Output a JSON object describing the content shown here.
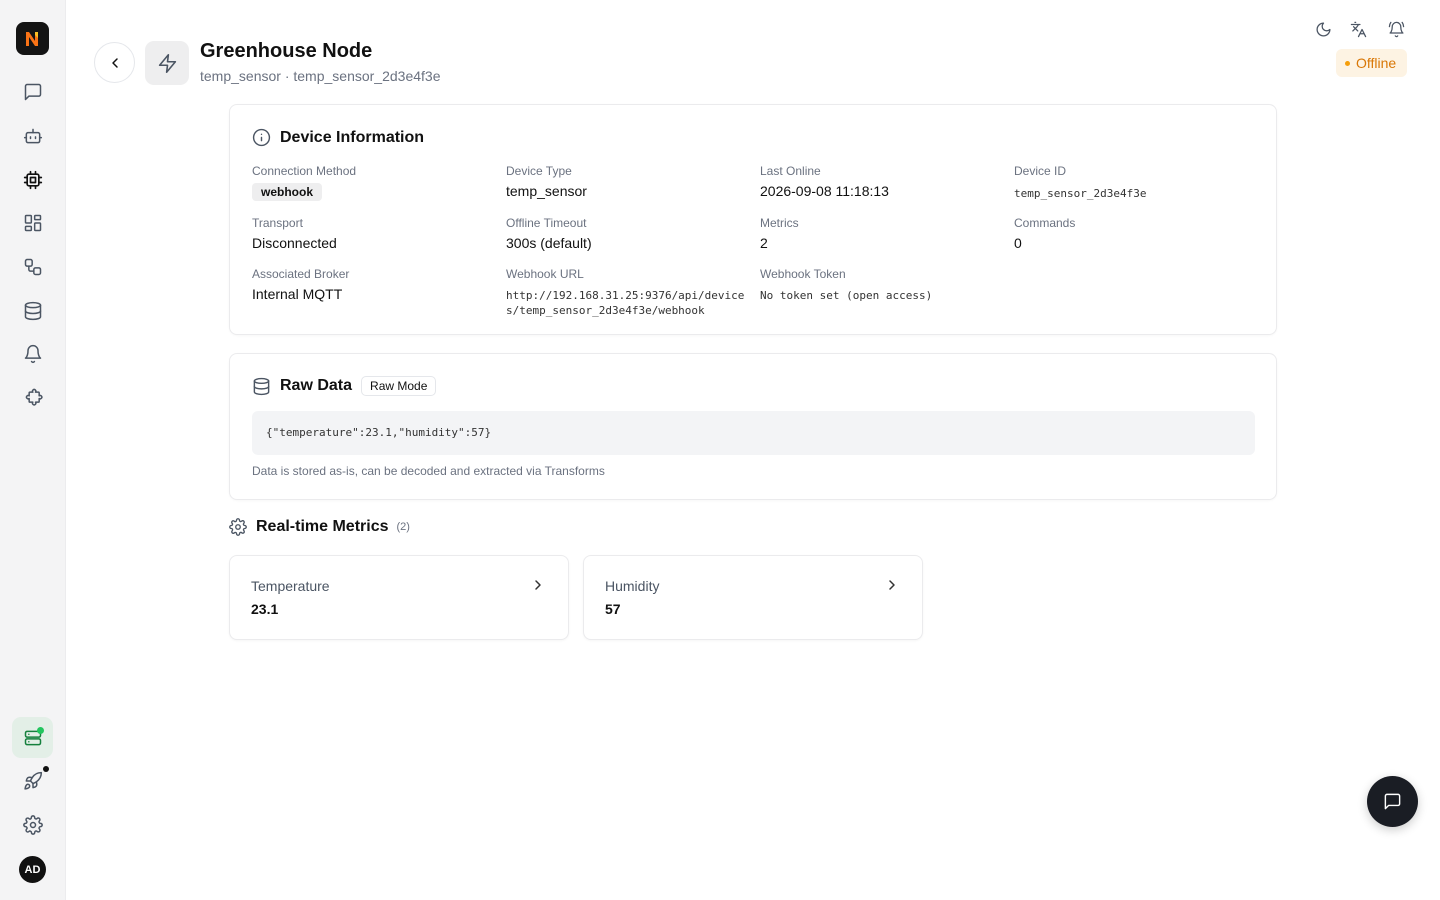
{
  "brand": {
    "logo_letter": "N",
    "accent": "#f97316"
  },
  "sidebar": {
    "items": [
      {
        "name": "chat",
        "icon": "message-square-icon"
      },
      {
        "name": "agents",
        "icon": "bot-icon"
      },
      {
        "name": "devices",
        "icon": "cpu-icon"
      },
      {
        "name": "dashboards",
        "icon": "layout-grid-icon"
      },
      {
        "name": "automation",
        "icon": "workflow-icon"
      },
      {
        "name": "data",
        "icon": "database-icon"
      },
      {
        "name": "alerts",
        "icon": "bell-icon"
      },
      {
        "name": "extensions",
        "icon": "puzzle-icon"
      }
    ],
    "bottom": [
      {
        "name": "system-status",
        "icon": "server-status-icon",
        "active": true
      },
      {
        "name": "getting-started",
        "icon": "rocket-icon"
      },
      {
        "name": "settings",
        "icon": "gear-icon"
      }
    ],
    "avatar_initials": "AD"
  },
  "header": {
    "title": "Greenhouse Node",
    "subtitle": "temp_sensor · temp_sensor_2d3e4f3e",
    "status": "Offline",
    "status_color": "#d97706"
  },
  "device_info": {
    "title": "Device Information",
    "connection_method": {
      "label": "Connection Method",
      "value": "webhook"
    },
    "device_type": {
      "label": "Device Type",
      "value": "temp_sensor"
    },
    "last_online": {
      "label": "Last Online",
      "value": "2026-09-08 11:18:13"
    },
    "device_id": {
      "label": "Device ID",
      "value": "temp_sensor_2d3e4f3e"
    },
    "transport": {
      "label": "Transport",
      "value": "Disconnected"
    },
    "offline_timeout": {
      "label": "Offline Timeout",
      "value": "300s (default)"
    },
    "metrics": {
      "label": "Metrics",
      "value": "2"
    },
    "commands": {
      "label": "Commands",
      "value": "0"
    },
    "broker": {
      "label": "Associated Broker",
      "value": "Internal MQTT"
    },
    "webhook_url": {
      "label": "Webhook URL",
      "line1": "http://192.168.31.25:9376/api/device",
      "line2": "s/temp_sensor_2d3e4f3e/webhook"
    },
    "webhook_token": {
      "label": "Webhook Token",
      "value": "No token set (open access)"
    }
  },
  "raw_data": {
    "title": "Raw Data",
    "mode_badge": "Raw Mode",
    "payload": "{\"temperature\":23.1,\"humidity\":57}",
    "note": "Data is stored as-is, can be decoded and extracted via Transforms"
  },
  "metrics_section": {
    "title": "Real-time Metrics",
    "count": "(2)",
    "items": [
      {
        "label": "Temperature",
        "value": "23.1"
      },
      {
        "label": "Humidity",
        "value": "57"
      }
    ]
  }
}
